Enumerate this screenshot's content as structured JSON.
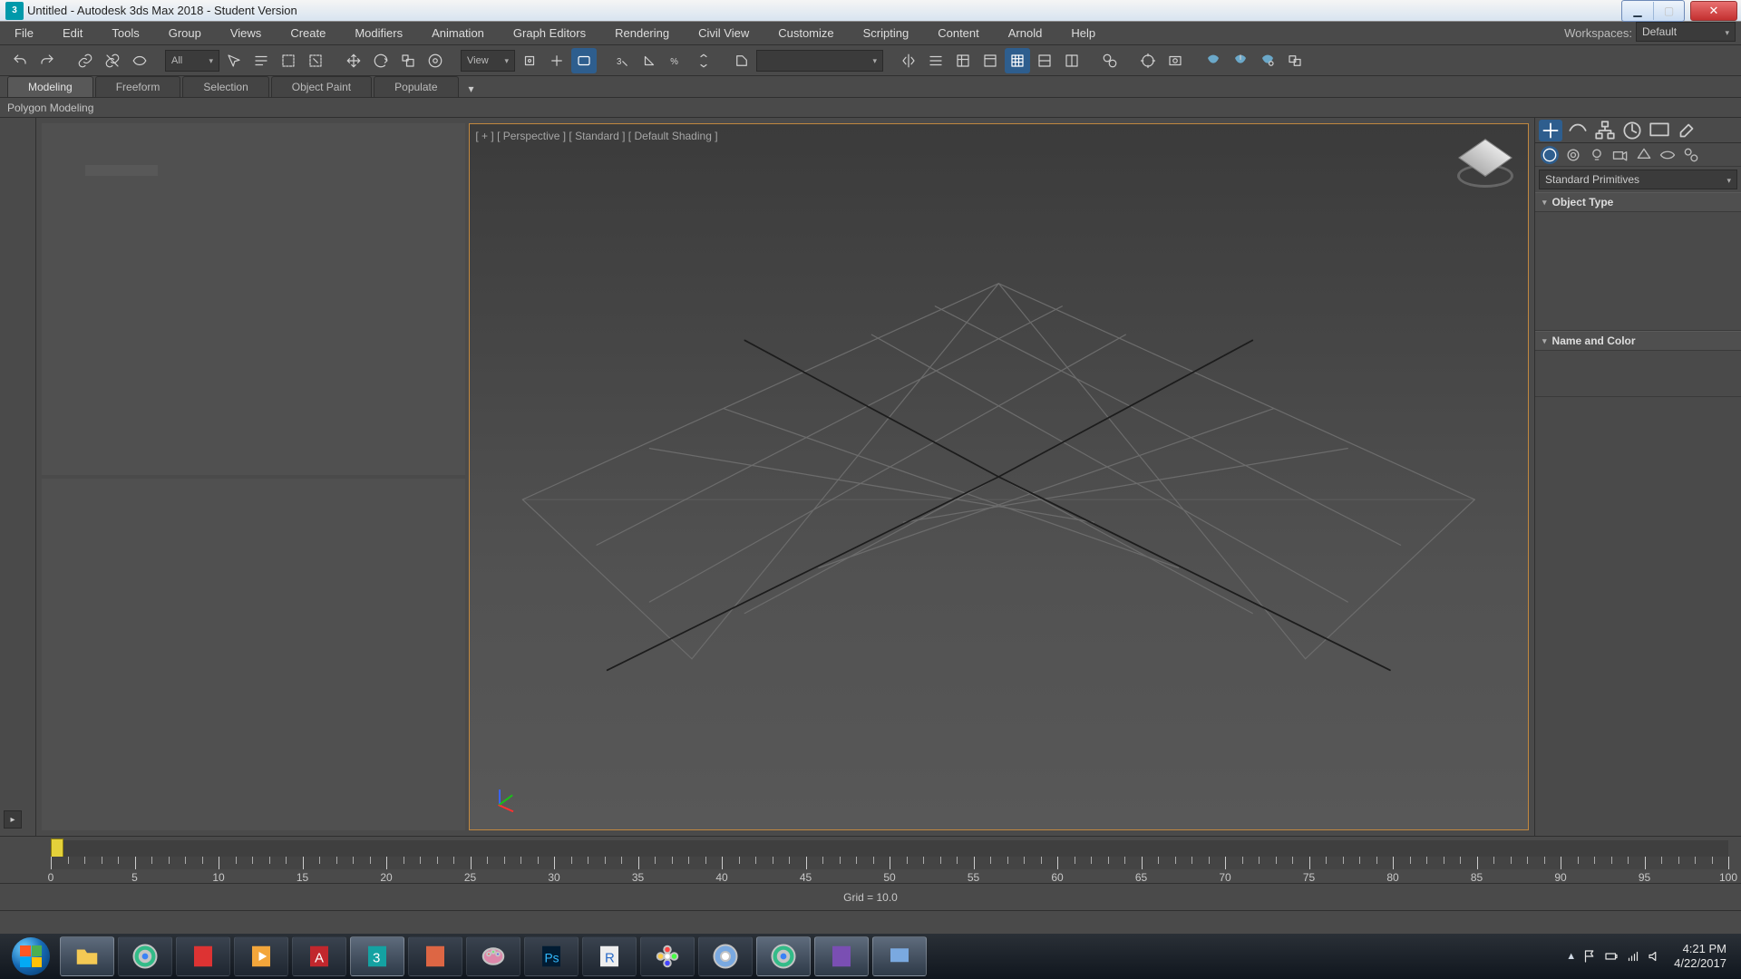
{
  "titlebar": {
    "logo": "3",
    "title": "Untitled - Autodesk 3ds Max 2018 - Student Version"
  },
  "menubar": {
    "items": [
      "File",
      "Edit",
      "Tools",
      "Group",
      "Views",
      "Create",
      "Modifiers",
      "Animation",
      "Graph Editors",
      "Rendering",
      "Civil View",
      "Customize",
      "Scripting",
      "Content",
      "Arnold",
      "Help"
    ],
    "workspaces_label": "Workspaces:",
    "workspaces_value": "Default"
  },
  "toolbar": {
    "selection_filter": "All",
    "coord_system": "View"
  },
  "ribbon": {
    "tabs": [
      "Modeling",
      "Freeform",
      "Selection",
      "Object Paint",
      "Populate"
    ],
    "active": 0,
    "sublabel": "Polygon Modeling"
  },
  "viewport": {
    "label": "[ + ] [ Perspective ] [ Standard ] [ Default Shading ]"
  },
  "cmdpanel": {
    "category": "Standard Primitives",
    "rollouts": [
      "Object Type",
      "Name and Color"
    ]
  },
  "timeline": {
    "start": 0,
    "end": 100,
    "step": 5
  },
  "statusbar": {
    "grid": "Grid  =  10.0"
  },
  "taskbar": {
    "time": "4:21 PM",
    "date": "4/22/2017"
  }
}
